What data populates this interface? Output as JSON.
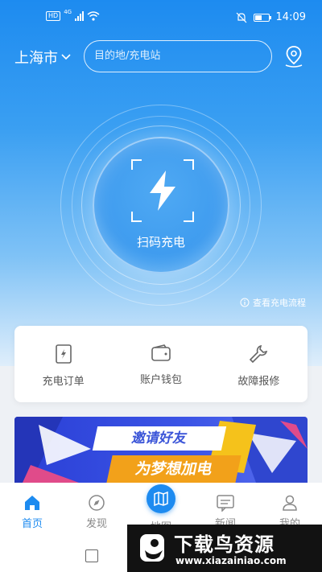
{
  "status_bar": {
    "network_badge": "HD",
    "network_type": "4G",
    "time": "14:09"
  },
  "header": {
    "city": "上海市",
    "search_placeholder": "目的地/充电站"
  },
  "scan": {
    "label": "扫码充电"
  },
  "flow_link": "查看充电流程",
  "quick_actions": [
    {
      "label": "充电订单",
      "icon": "order-icon"
    },
    {
      "label": "账户钱包",
      "icon": "wallet-icon"
    },
    {
      "label": "故障报修",
      "icon": "wrench-icon"
    }
  ],
  "banner": {
    "line1": "邀请好友",
    "line2": "为梦想加电"
  },
  "bottom_nav": [
    {
      "label": "首页",
      "icon": "home-icon",
      "active": true
    },
    {
      "label": "发现",
      "icon": "compass-icon",
      "active": false
    },
    {
      "label": "地图",
      "icon": "map-icon",
      "active": false
    },
    {
      "label": "新闻",
      "icon": "news-icon",
      "active": false
    },
    {
      "label": "我的",
      "icon": "user-icon",
      "active": false
    }
  ],
  "watermark": {
    "title": "下载鸟资源",
    "url": "www.xiazainiao.com"
  },
  "colors": {
    "primary": "#1d8bf0",
    "accent_orange": "#f2a11a"
  }
}
